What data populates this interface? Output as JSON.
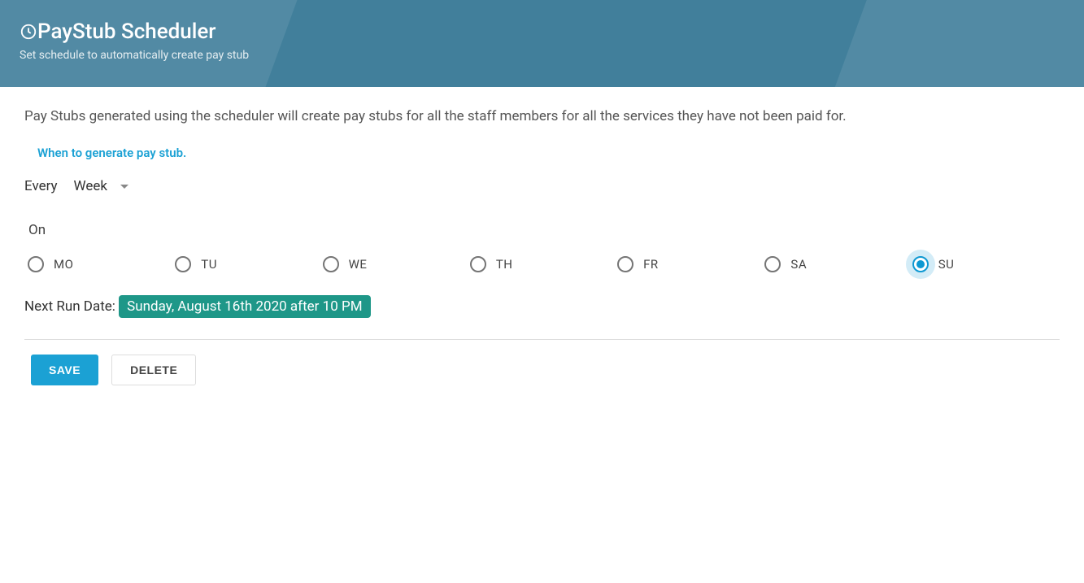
{
  "header": {
    "title": "PayStub Scheduler",
    "subtitle": "Set schedule to automatically create pay stub"
  },
  "content": {
    "description": "Pay Stubs generated using the scheduler will create pay stubs for all the staff members for all the services they have not been paid for.",
    "section_label": "When to generate pay stub.",
    "frequency_label": "Every",
    "frequency_value": "Week",
    "on_label": "On",
    "days": [
      {
        "label": "MO",
        "selected": false
      },
      {
        "label": "TU",
        "selected": false
      },
      {
        "label": "WE",
        "selected": false
      },
      {
        "label": "TH",
        "selected": false
      },
      {
        "label": "FR",
        "selected": false
      },
      {
        "label": "SA",
        "selected": false
      },
      {
        "label": "SU",
        "selected": true
      }
    ],
    "next_run_label": "Next Run Date: ",
    "next_run_value": "Sunday, August 16th 2020 after 10 PM",
    "save_label": "Save",
    "delete_label": "Delete"
  }
}
